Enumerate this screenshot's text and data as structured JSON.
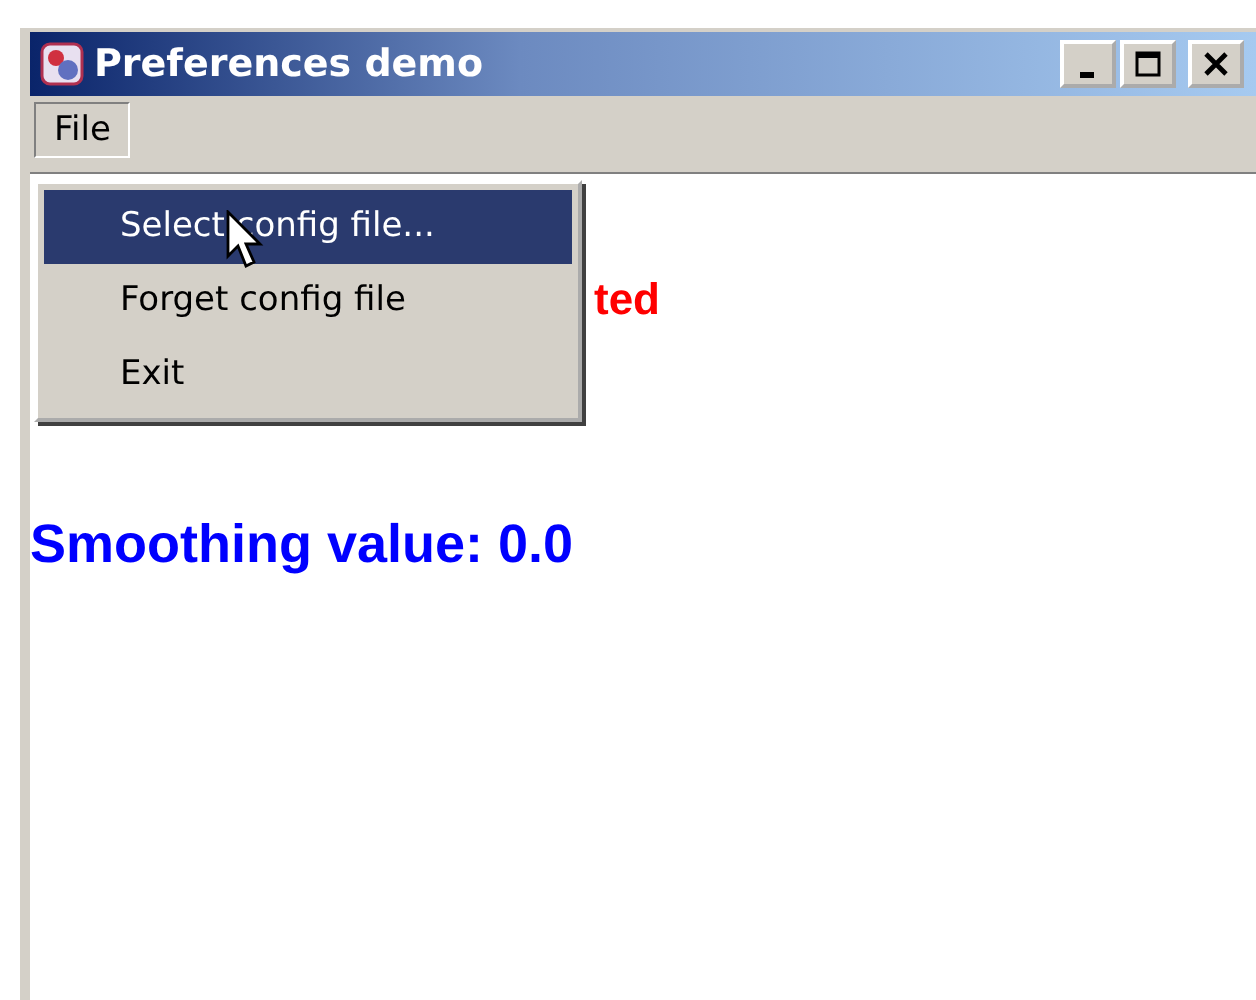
{
  "window": {
    "title": "Preferences demo"
  },
  "menu_bar": [
    {
      "label": "File",
      "selected": true
    }
  ],
  "menu": {
    "items": [
      {
        "label": "Select config file...",
        "selected": true
      },
      {
        "label": "Forget config file",
        "selected": false
      },
      {
        "label": "Exit",
        "selected": false
      }
    ]
  },
  "content": {
    "status_text": "ted",
    "smoothing_text": "Smoothing value: 0.0"
  }
}
